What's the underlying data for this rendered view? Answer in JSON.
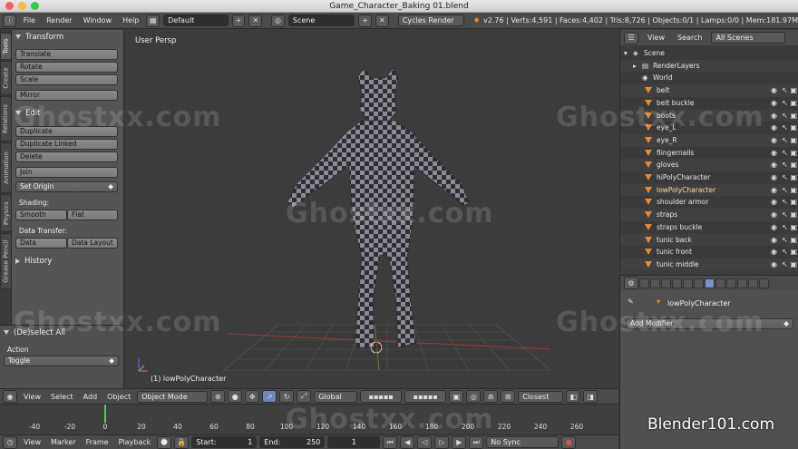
{
  "window": {
    "title": "Game_Character_Baking 01.blend",
    "traffic_colors": [
      "#fc605c",
      "#fdbc40",
      "#34c84a"
    ]
  },
  "infobar": {
    "menus": [
      "File",
      "Render",
      "Window",
      "Help"
    ],
    "screen_layout": "Default",
    "scene": "Scene",
    "render_engine": "Cycles Render",
    "stats": "v2.76 | Verts:4,591 | Faces:4,402 | Tris:8,726 | Objects:0/1 | Lamps:0/0 | Mem:181.97M"
  },
  "tabs": [
    "Tools",
    "Create",
    "Relations",
    "Animation",
    "Physics",
    "Grease Pencil"
  ],
  "shelf": {
    "transform_header": "Transform",
    "translate": "Translate",
    "rotate": "Rotate",
    "scale": "Scale",
    "mirror": "Mirror",
    "edit_header": "Edit",
    "duplicate": "Duplicate",
    "duplicate_linked": "Duplicate Linked",
    "delete": "Delete",
    "join": "Join",
    "set_origin": "Set Origin",
    "shading_label": "Shading:",
    "smooth": "Smooth",
    "flat": "Flat",
    "data_transfer_label": "Data Transfer:",
    "data": "Data",
    "data_layout": "Data Layout",
    "history_header": "History"
  },
  "redo": {
    "header": "(De)select All",
    "action_label": "Action",
    "action_value": "Toggle"
  },
  "viewport": {
    "label": "User Persp",
    "object": "(1) lowPolyCharacter"
  },
  "vphead": {
    "menus": [
      "View",
      "Select",
      "Add",
      "Object"
    ],
    "mode": "Object Mode",
    "orientation": "Global",
    "snap": "Closest"
  },
  "timeline": {
    "ticks": [
      "-40",
      "-20",
      "0",
      "20",
      "40",
      "60",
      "80",
      "100",
      "120",
      "140",
      "160",
      "180",
      "200",
      "220",
      "240",
      "260"
    ],
    "menus": [
      "View",
      "Marker",
      "Frame",
      "Playback"
    ],
    "start_label": "Start:",
    "start": "1",
    "end_label": "End:",
    "end": "250",
    "current": "1",
    "sync": "No Sync"
  },
  "outliner": {
    "menus": [
      "View",
      "Search"
    ],
    "filter": "All Scenes",
    "scene": "Scene",
    "render_layers": "RenderLayers",
    "world": "World",
    "objects": [
      "belt",
      "belt buckle",
      "boots",
      "eye_L",
      "eye_R",
      "fiingernails",
      "gloves",
      "hiPolyCharacter",
      "lowPolyCharacter",
      "shoulder armor",
      "straps",
      "straps buckle",
      "tunic back",
      "tunic front",
      "tunic middle"
    ],
    "selected": "lowPolyCharacter"
  },
  "properties": {
    "object": "lowPolyCharacter",
    "add_modifier": "Add Modifier"
  },
  "watermark": "Ghostxx.com",
  "brand": "Blender101.com"
}
